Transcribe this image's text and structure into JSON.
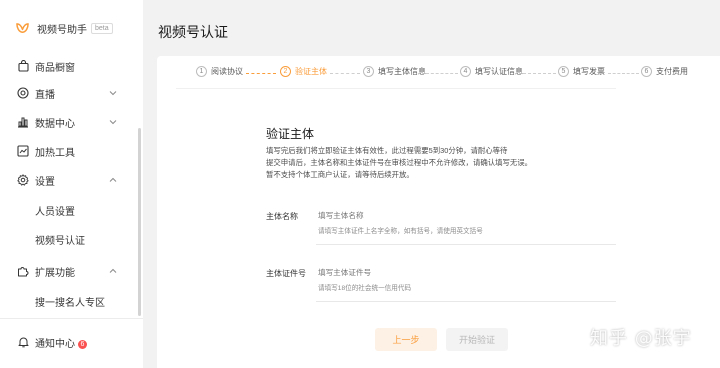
{
  "app": {
    "name": "视频号助手",
    "beta": "beta"
  },
  "sidebar": {
    "items": [
      {
        "label": "商品橱窗",
        "icon": "shopping-bag-icon"
      },
      {
        "label": "直播",
        "icon": "live-icon",
        "chevron": "down"
      },
      {
        "label": "数据中心",
        "icon": "bar-chart-icon",
        "chevron": "down"
      },
      {
        "label": "加热工具",
        "icon": "trend-icon"
      },
      {
        "label": "设置",
        "icon": "gear-icon",
        "chevron": "up"
      },
      {
        "label": "人员设置"
      },
      {
        "label": "视频号认证"
      },
      {
        "label": "扩展功能",
        "icon": "puzzle-icon",
        "chevron": "up"
      },
      {
        "label": "搜一搜名人专区"
      }
    ],
    "notify": {
      "label": "通知中心",
      "count": "6"
    }
  },
  "page": {
    "title": "视频号认证"
  },
  "steps": [
    {
      "num": "1",
      "label": "阅读协议"
    },
    {
      "num": "2",
      "label": "验证主体",
      "active": true
    },
    {
      "num": "3",
      "label": "填写主体信息"
    },
    {
      "num": "4",
      "label": "填写认证信息"
    },
    {
      "num": "5",
      "label": "填写发票"
    },
    {
      "num": "6",
      "label": "支付费用"
    }
  ],
  "section": {
    "title": "验证主体",
    "intro": [
      "填写完后我们将立即验证主体有效性，此过程需要5到30分钟，请耐心等待",
      "提交申请后，主体名称和主体证件号在审核过程中不允许修改，请确认填写无误。",
      "暂不支持个体工商户认证，请等待后续开放。"
    ]
  },
  "form": {
    "name": {
      "label": "主体名称",
      "placeholder": "填写主体名称",
      "hint": "请填写主体证件上名字全称，如有括号，请使用英文括号"
    },
    "id": {
      "label": "主体证件号",
      "placeholder": "填写主体证件号",
      "hint": "请填写18位的社会统一信用代码"
    }
  },
  "buttons": {
    "prev": "上一步",
    "start": "开始验证"
  },
  "watermark": "知乎 @张宇",
  "colors": {
    "accent": "#fa9d3b",
    "badge": "#fa5151"
  }
}
